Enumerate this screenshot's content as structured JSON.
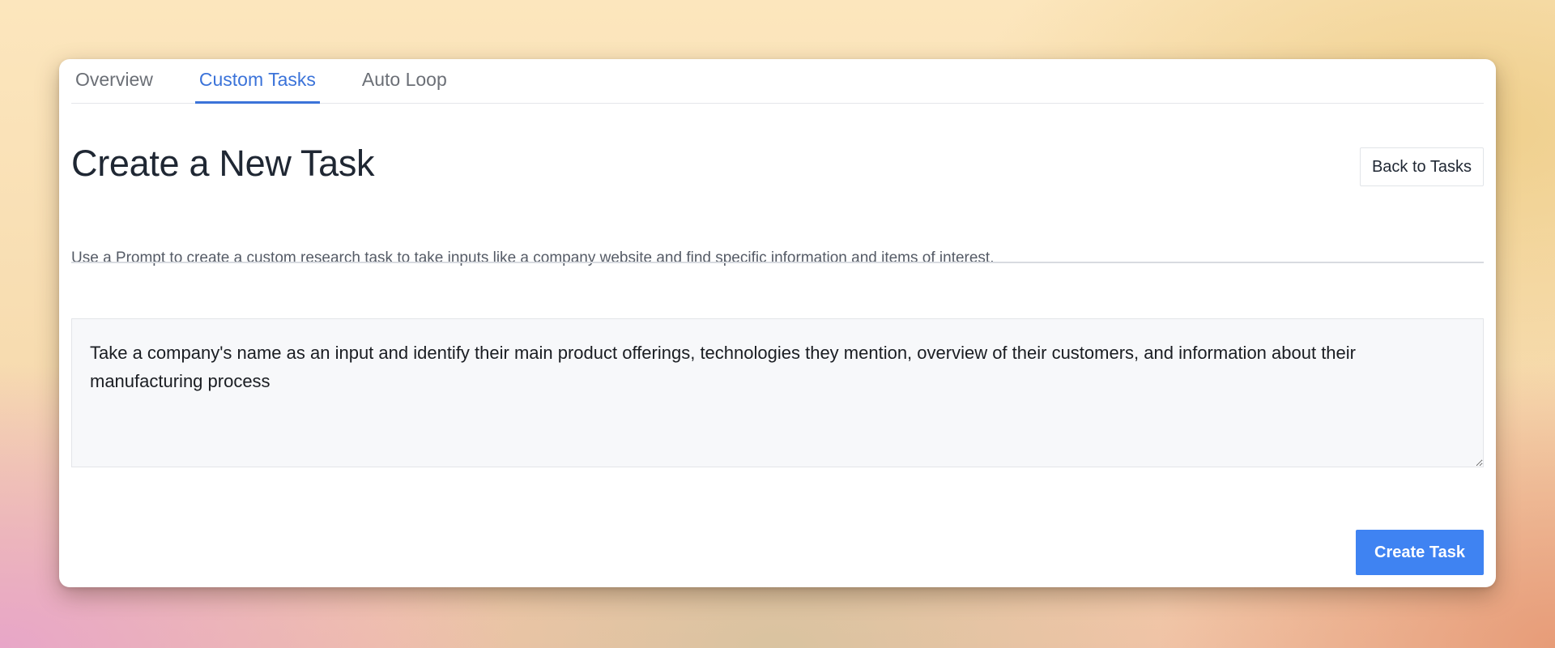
{
  "tabs": [
    {
      "label": "Overview",
      "active": false
    },
    {
      "label": "Custom Tasks",
      "active": true
    },
    {
      "label": "Auto Loop",
      "active": false
    }
  ],
  "header": {
    "title": "Create a New Task",
    "back_label": "Back to Tasks",
    "subtitle": "Use a Prompt to create a custom research task to take inputs like a company website and find specific information and items of interest."
  },
  "prompt": {
    "value": "Take a company's name as an input and identify their main product offerings, technologies they mention, overview of their customers, and information about their manufacturing process"
  },
  "actions": {
    "create_label": "Create Task"
  },
  "colors": {
    "accent": "#3b73d9",
    "primary_button": "#3f83f2"
  }
}
